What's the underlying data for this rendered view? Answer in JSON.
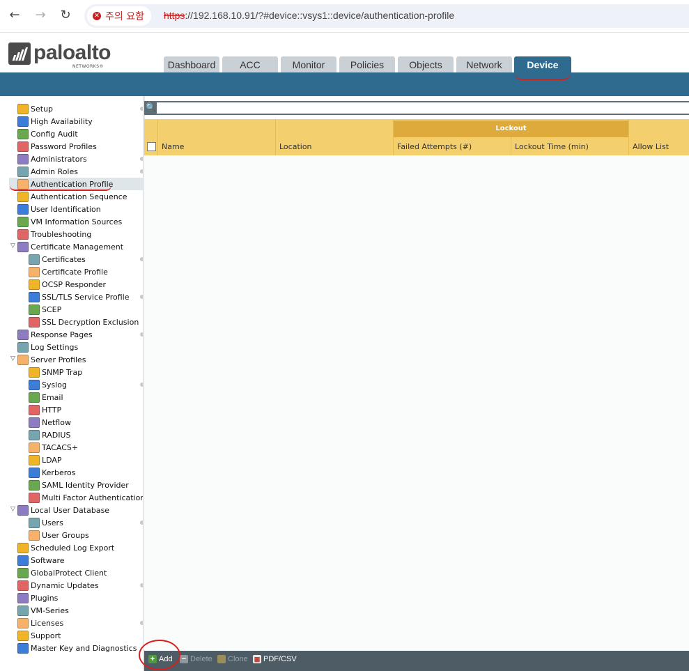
{
  "browser": {
    "warning_label": "주의 요함",
    "url_scheme": "https",
    "url_rest": "://192.168.10.91/?#device::vsys1::device/authentication-profile"
  },
  "logo": {
    "name": "paloalto",
    "sub": "NETWORKS®"
  },
  "tabs": [
    {
      "label": "Dashboard"
    },
    {
      "label": "ACC"
    },
    {
      "label": "Monitor"
    },
    {
      "label": "Policies"
    },
    {
      "label": "Objects"
    },
    {
      "label": "Network"
    },
    {
      "label": "Device",
      "active": true
    }
  ],
  "nav": [
    {
      "label": "Setup",
      "icon": "setup-icon",
      "dot": true
    },
    {
      "label": "High Availability",
      "icon": "ha-icon"
    },
    {
      "label": "Config Audit",
      "icon": "config-audit-icon"
    },
    {
      "label": "Password Profiles",
      "icon": "password-icon"
    },
    {
      "label": "Administrators",
      "icon": "admin-icon",
      "dot": true
    },
    {
      "label": "Admin Roles",
      "icon": "admin-roles-icon",
      "dot": true
    },
    {
      "label": "Authentication Profile",
      "icon": "auth-profile-icon",
      "selected": true
    },
    {
      "label": "Authentication Sequence",
      "icon": "auth-sequence-icon"
    },
    {
      "label": "User Identification",
      "icon": "user-id-icon"
    },
    {
      "label": "VM Information Sources",
      "icon": "vm-info-icon"
    },
    {
      "label": "Troubleshooting",
      "icon": "troubleshooting-icon"
    },
    {
      "label": "Certificate Management",
      "icon": "folder-icon",
      "expanded": true
    },
    {
      "label": "Certificates",
      "icon": "certificate-icon",
      "indent": 1,
      "dot": true
    },
    {
      "label": "Certificate Profile",
      "icon": "certificate-profile-icon",
      "indent": 1
    },
    {
      "label": "OCSP Responder",
      "icon": "ocsp-icon",
      "indent": 1
    },
    {
      "label": "SSL/TLS Service Profile",
      "icon": "lock-icon",
      "indent": 1,
      "dot": true
    },
    {
      "label": "SCEP",
      "icon": "scep-icon",
      "indent": 1
    },
    {
      "label": "SSL Decryption Exclusion",
      "icon": "lock-icon",
      "indent": 1
    },
    {
      "label": "Response Pages",
      "icon": "response-pages-icon",
      "dot": true
    },
    {
      "label": "Log Settings",
      "icon": "log-settings-icon"
    },
    {
      "label": "Server Profiles",
      "icon": "folder-icon",
      "expanded": true
    },
    {
      "label": "SNMP Trap",
      "icon": "snmp-icon",
      "indent": 1
    },
    {
      "label": "Syslog",
      "icon": "syslog-icon",
      "indent": 1,
      "dot": true
    },
    {
      "label": "Email",
      "icon": "email-icon",
      "indent": 1
    },
    {
      "label": "HTTP",
      "icon": "http-icon",
      "indent": 1
    },
    {
      "label": "Netflow",
      "icon": "netflow-icon",
      "indent": 1
    },
    {
      "label": "RADIUS",
      "icon": "radius-icon",
      "indent": 1
    },
    {
      "label": "TACACS+",
      "icon": "tacacs-icon",
      "indent": 1
    },
    {
      "label": "LDAP",
      "icon": "ldap-icon",
      "indent": 1
    },
    {
      "label": "Kerberos",
      "icon": "kerberos-icon",
      "indent": 1
    },
    {
      "label": "SAML Identity Provider",
      "icon": "saml-icon",
      "indent": 1
    },
    {
      "label": "Multi Factor Authentication",
      "icon": "mfa-icon",
      "indent": 1
    },
    {
      "label": "Local User Database",
      "icon": "folder-icon",
      "expanded": true
    },
    {
      "label": "Users",
      "icon": "user-icon",
      "indent": 1,
      "dot": true
    },
    {
      "label": "User Groups",
      "icon": "user-groups-icon",
      "indent": 1
    },
    {
      "label": "Scheduled Log Export",
      "icon": "log-export-icon"
    },
    {
      "label": "Software",
      "icon": "software-icon"
    },
    {
      "label": "GlobalProtect Client",
      "icon": "globalprotect-icon"
    },
    {
      "label": "Dynamic Updates",
      "icon": "dynamic-updates-icon",
      "dot": true
    },
    {
      "label": "Plugins",
      "icon": "plugins-icon"
    },
    {
      "label": "VM-Series",
      "icon": "vm-series-icon"
    },
    {
      "label": "Licenses",
      "icon": "license-key-icon",
      "dot": true
    },
    {
      "label": "Support",
      "icon": "support-icon"
    },
    {
      "label": "Master Key and Diagnostics",
      "icon": "lock-icon"
    }
  ],
  "grid": {
    "group_header": "Lockout",
    "columns": [
      "Name",
      "Location",
      "Failed Attempts (#)",
      "Lockout Time (min)",
      "Allow List"
    ],
    "rows": []
  },
  "toolbar": {
    "add": "Add",
    "delete": "Delete",
    "clone": "Clone",
    "pdfcsv": "PDF/CSV"
  },
  "colors": {
    "brand_blue": "#2f6b8e",
    "header_gold": "#f4cf6e",
    "lockout_gold": "#deaa3c",
    "annotation_red": "#d62020"
  }
}
